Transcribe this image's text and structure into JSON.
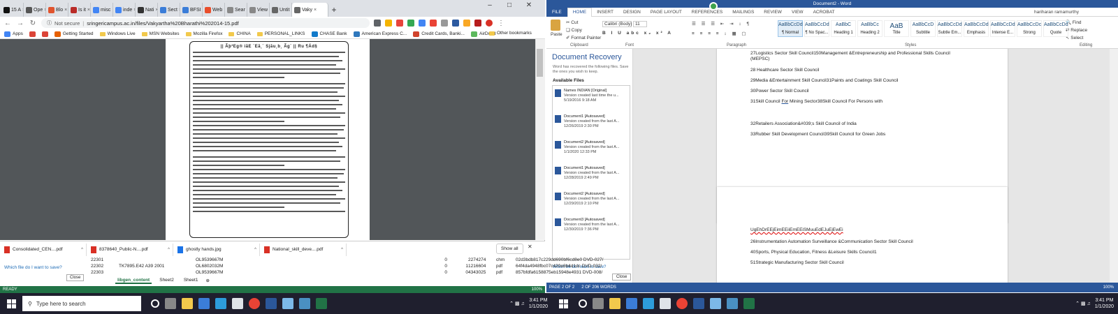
{
  "chrome": {
    "tabs": [
      {
        "label": "15 A",
        "color": "#111111"
      },
      {
        "label": "Ope",
        "color": "#555555"
      },
      {
        "label": "Blo",
        "color": "#e0542e"
      },
      {
        "label": "Is it",
        "color": "#b92b27"
      },
      {
        "label": "misc",
        "color": "#4285f4"
      },
      {
        "label": "inde",
        "color": "#4285f4"
      },
      {
        "label": "Nati",
        "color": "#333333"
      },
      {
        "label": "Sect",
        "color": "#3b7dd8"
      },
      {
        "label": "BFSI",
        "color": "#3b7dd8"
      },
      {
        "label": "Web",
        "color": "#e94e2c"
      },
      {
        "label": "Sear",
        "color": "#888888"
      },
      {
        "label": "View",
        "color": "#888888"
      },
      {
        "label": "Untit",
        "color": "#666666"
      },
      {
        "label": "Vaky",
        "color": "#666666",
        "active": true
      }
    ],
    "url_prefix": "Not secure",
    "url": "sringericampus.ac.in/files/Vakyartha%20Bharathi%202014-15.pdf",
    "bookmarks": [
      {
        "label": "Apps",
        "color": "#4285f4"
      },
      {
        "label": "",
        "color": "#db4437"
      },
      {
        "label": "",
        "color": "#db4437"
      },
      {
        "label": "Getting Started",
        "color": "#e66000"
      },
      {
        "label": "Windows Live",
        "color": "#f2c94c",
        "folder": true
      },
      {
        "label": "MSN Websites",
        "color": "#f2c94c",
        "folder": true
      },
      {
        "label": "Mozilla Firefox",
        "color": "#f2c94c",
        "folder": true
      },
      {
        "label": "CHINA",
        "color": "#f2c94c",
        "folder": true
      },
      {
        "label": "PERSONAL_LINKS",
        "color": "#f2c94c",
        "folder": true
      },
      {
        "label": "CHASE Bank",
        "color": "#117aca"
      },
      {
        "label": "American Express C...",
        "color": "#2e77bc"
      },
      {
        "label": "Credit Cards, Banki...",
        "color": "#d1442d"
      },
      {
        "label": "AirDroid",
        "color": "#5cb85c"
      }
    ],
    "other_bookmarks": "Other bookmarks",
    "pdf_header": "|| Ãþ³Eg® iãE ¨Eã¸¨ Sjãu¸b¸ Ãg¨ || Ru ¶Ád§"
  },
  "downloads": {
    "items": [
      {
        "name": "Consolidated_CEN....pdf",
        "kind": "pdf"
      },
      {
        "name": "8378640_Public-N....pdf",
        "kind": "pdf"
      },
      {
        "name": "ghostly hands.jpg",
        "kind": "img"
      },
      {
        "name": "National_skill_deve....pdf",
        "kind": "pdf"
      }
    ],
    "show_all": "Show all"
  },
  "excel": {
    "rows": [
      {
        "a": "22301",
        "b": "",
        "c": "OL9539667M",
        "d": "0",
        "e": "",
        "f": "2274274",
        "g": "chm",
        "h": "02d3bdb817c229dd690bf6cd8e0 DVD-027/"
      },
      {
        "a": "22302",
        "b": "TK7895.E42 A39 2001",
        "c": "OL6802032M",
        "d": "0",
        "e": "1",
        "f": "1216604",
        "g": "pdf",
        "h": "64f4da4948fbc07c420e8b4d1dc DVD-032/"
      },
      {
        "a": "22303",
        "b": "",
        "c": "OL9539667M",
        "d": "0",
        "e": "0",
        "f": "4343025",
        "g": "pdf",
        "h": "857bfdfa6158875eb15948e4931 DVD-008/"
      }
    ],
    "sheets": [
      "libgen_content",
      "Sheet2",
      "Sheet1"
    ],
    "status_left": "READY",
    "zoom": "100%",
    "help": "Which file do I want to save?",
    "close": "Close"
  },
  "word": {
    "title": "Document2 - Word",
    "tabs": [
      "FILE",
      "HOME",
      "INSERT",
      "DESIGN",
      "PAGE LAYOUT",
      "REFERENCES",
      "MAILINGS",
      "REVIEW",
      "VIEW",
      "ACROBAT"
    ],
    "user": "hariharan ramamurthy",
    "ribbon": {
      "clipboard": {
        "paste": "Paste",
        "cut": "Cut",
        "copy": "Copy",
        "format_painter": "Format Painter",
        "label": "Clipboard"
      },
      "font": {
        "name": "Calibri (Body)",
        "size": "11",
        "label": "Font"
      },
      "paragraph_label": "Paragraph",
      "styles_label": "Styles",
      "editing": {
        "find": "Find",
        "replace": "Replace",
        "select": "Select",
        "label": "Editing"
      },
      "styles": [
        {
          "preview": "AaBbCcDd",
          "name": "¶ Normal"
        },
        {
          "preview": "AaBbCcDd",
          "name": "¶ No Spac..."
        },
        {
          "preview": "AaBbC",
          "name": "Heading 1"
        },
        {
          "preview": "AaBbCc",
          "name": "Heading 2"
        },
        {
          "preview": "AaB",
          "name": "Title"
        },
        {
          "preview": "AaBbCcD",
          "name": "Subtitle"
        },
        {
          "preview": "AaBbCcDd",
          "name": "Subtle Em..."
        },
        {
          "preview": "AaBbCcDd",
          "name": "Emphasis"
        },
        {
          "preview": "AaBbCcDd",
          "name": "Intense E..."
        },
        {
          "preview": "AaBbCcDc",
          "name": "Strong"
        },
        {
          "preview": "AaBbCcDd",
          "name": "Quote"
        }
      ]
    },
    "recovery": {
      "title": "Document Recovery",
      "subtitle": "Word has recovered the following files. Save the ones you wish to keep.",
      "available": "Available Files",
      "files": [
        {
          "name": "Names INDIAN  [Original]",
          "desc": "Version created last time the u...",
          "date": "5/19/2016 9:18 AM"
        },
        {
          "name": "Document1  [Autosaved]",
          "desc": "Version created from the last A...",
          "date": "12/26/2019 2:30 PM"
        },
        {
          "name": "Document2  [Autosaved]",
          "desc": "Version created from the last A...",
          "date": "1/1/2020 12:33 PM"
        },
        {
          "name": "Document1  [Autosaved]",
          "desc": "Version created from the last A...",
          "date": "12/28/2019 2:49 PM"
        },
        {
          "name": "Document2  [Autosaved]",
          "desc": "Version created from the last A...",
          "date": "12/29/2019 2:10 PM"
        },
        {
          "name": "Document3  [Autosaved]",
          "desc": "Version created from the last A...",
          "date": "12/30/2019 7:36 PM"
        }
      ],
      "which": "Which file do I want to save?",
      "close": "Close"
    },
    "page1_lines": [
      "27Logistics Sector Skill Council150Management &Entrepreneurship and Professional Skills Council",
      "(MEPSC)",
      "28 Healthcare Sector Skill Council",
      "29Media &Entertainment Skill Council31Paints and Coatings Skill Council",
      "30Power Sector Skill Council",
      "31Skill Council For Mining Sector38Skill Council For Persons with",
      "32Retailers Association&#039;s Skill Council of India",
      "33Rubber Skill Development Council39Skill Council for Green Jobs"
    ],
    "page2_lines": [
      "UgEhDrEEjEimEEiiEmEEiSMuuEdEJuEjEwEi",
      "26Instrumentation Automation Surveillance &Communication Sector Skill Council",
      "40Sports, Physical Education, Fitness &Leisure Skills Council1",
      "51Strategic Manufacturing Sector Skill Council"
    ],
    "status": {
      "page": "PAGE 2 OF 2",
      "words": "2 OF 206 WORDS",
      "zoom": "100%"
    }
  },
  "taskbar": {
    "search": "Type here to search",
    "time": "3:41 PM",
    "date": "1/1/2020"
  }
}
